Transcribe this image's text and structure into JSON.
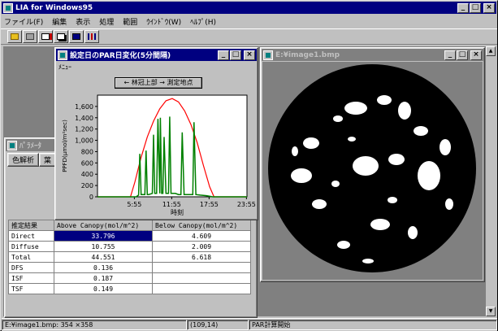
{
  "app": {
    "title": "LIA for Windows95"
  },
  "menu": [
    "ファイル(F)",
    "編集",
    "表示",
    "処理",
    "範囲",
    "ｳｲﾝﾄﾞｳ(W)",
    "ﾍﾙﾌﾟ(H)"
  ],
  "toolbar_icons": [
    "open-folder-icon",
    "settings-folder-icon",
    "print-preview-icon",
    "copy-icon",
    "save-icon",
    "chart-icon"
  ],
  "graph_window": {
    "title": "設定日のPAR日変化(5分間隔)",
    "menu": "ﾒﾆｭｰ",
    "mode_button": "← 林冠上部 → 測定地点"
  },
  "image_window": {
    "title": "E:¥image1.bmp"
  },
  "analysis_window": {
    "title": "ﾊﾟﾗﾒｰﾀ",
    "tabs": [
      "色解析",
      "葉"
    ]
  },
  "results_table": {
    "headers": [
      "推定結果",
      "Above Canopy(mol/m^2)",
      "Below Canopy(mol/m^2)"
    ],
    "rows": [
      {
        "label": "Direct",
        "above": "33.796",
        "below": "4.609"
      },
      {
        "label": "Diffuse",
        "above": "10.755",
        "below": "2.009"
      },
      {
        "label": "Total",
        "above": "44.551",
        "below": "6.618"
      },
      {
        "label": "DFS",
        "above": "0.136",
        "below": ""
      },
      {
        "label": "ISF",
        "above": "0.187",
        "below": ""
      },
      {
        "label": "TSF",
        "above": "0.149",
        "below": ""
      }
    ]
  },
  "statusbar": {
    "file": "E:¥image1.bmp: 354 ×358",
    "coords": "(109,14)",
    "status": "PAR計算開始"
  },
  "chart_data": {
    "type": "line",
    "ylabel": "PPFD(μmol/m²sec)",
    "xlabel": "時刻",
    "yticks": [
      "1,600",
      "1,400",
      "1,200",
      "1,000",
      "800",
      "600",
      "400",
      "200",
      "0"
    ],
    "xticks": [
      "5:55",
      "11:55",
      "17:55",
      "23:55"
    ],
    "ylim": [
      0,
      1800
    ],
    "xlim": [
      0,
      24
    ],
    "colors": {
      "above": "#ff0000",
      "below": "#008000"
    },
    "series": [
      {
        "x": [
          0,
          5.3,
          6,
          7,
          8,
          9,
          10,
          11,
          12,
          13,
          14,
          15,
          16,
          17,
          18,
          18.7,
          24
        ],
        "y": [
          0,
          0,
          260,
          700,
          1060,
          1340,
          1560,
          1700,
          1740,
          1680,
          1520,
          1280,
          960,
          560,
          180,
          0,
          0
        ]
      },
      {
        "x": [
          0,
          6.2,
          6.6,
          6.8,
          7.0,
          7.6,
          7.8,
          8.0,
          8.2,
          8.8,
          9.0,
          9.2,
          9.5,
          9.7,
          10.0,
          10.1,
          10.3,
          10.5,
          10.7,
          11.0,
          11.4,
          11.6,
          11.8,
          12.5,
          13.0,
          13.4,
          13.6,
          13.9,
          14.5,
          15.0,
          15.3,
          15.5,
          15.8,
          16.5,
          17.5,
          18.5,
          24
        ],
        "y": [
          0,
          0,
          30,
          760,
          40,
          40,
          820,
          40,
          40,
          60,
          1100,
          60,
          60,
          1380,
          60,
          1400,
          60,
          60,
          1060,
          60,
          60,
          1420,
          60,
          60,
          40,
          40,
          1140,
          40,
          40,
          40,
          40,
          1320,
          40,
          30,
          20,
          0,
          0
        ]
      }
    ]
  }
}
